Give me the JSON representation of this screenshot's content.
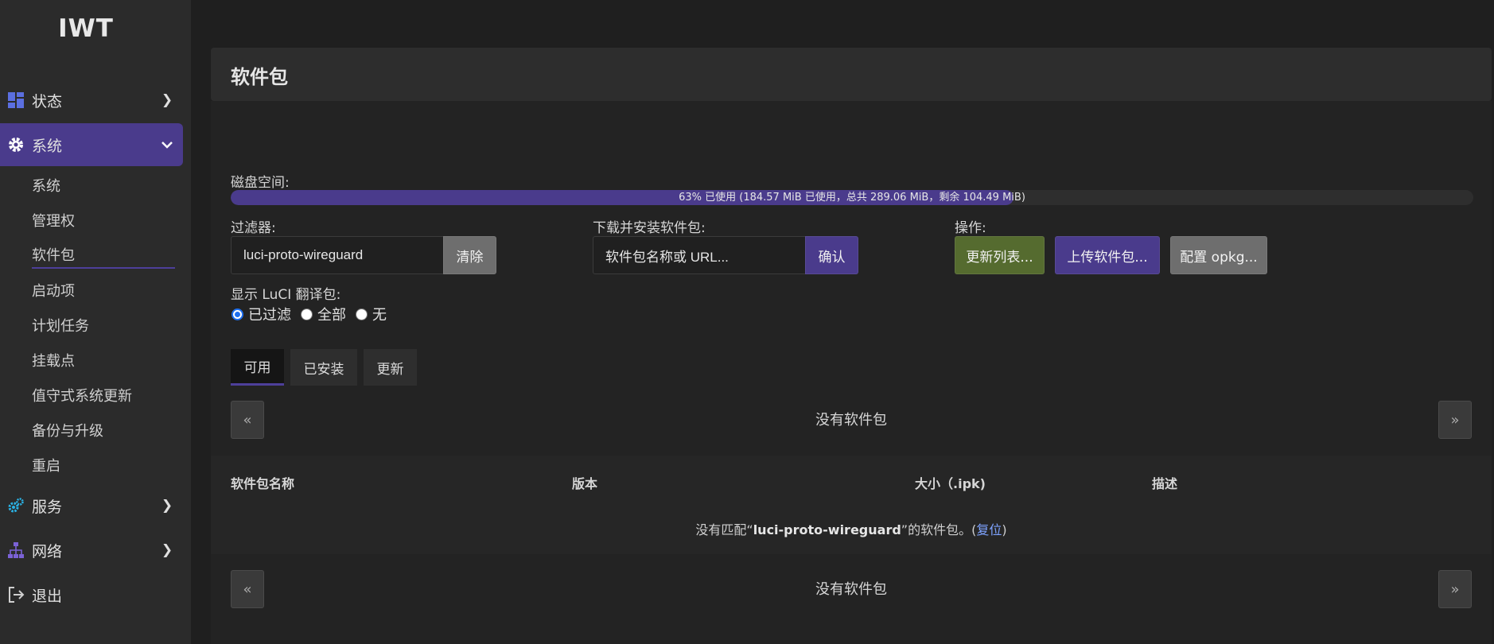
{
  "sidebar": {
    "logo": "IWT",
    "items": [
      {
        "label": "状态",
        "icon": "dashboard-icon",
        "expanded": false
      },
      {
        "label": "系统",
        "icon": "gear-icon",
        "expanded": true
      },
      {
        "label": "服务",
        "icon": "services-gear-icon",
        "expanded": false
      },
      {
        "label": "网络",
        "icon": "network-icon",
        "expanded": false
      },
      {
        "label": "退出",
        "icon": "logout-icon"
      }
    ],
    "sub_items": [
      "系统",
      "管理权",
      "软件包",
      "启动项",
      "计划任务",
      "挂载点",
      "值守式系统更新",
      "备份与升级",
      "重启"
    ],
    "current_sub": "软件包"
  },
  "page": {
    "title": "软件包",
    "disk_label": "磁盘空间:",
    "disk_used_fraction": 0.63,
    "disk_text": "63% 已使用 (184.57 MiB 已使用，总共 289.06 MiB，剩余 104.49 MiB)",
    "filter_label": "过滤器:",
    "filter_value": "luci-proto-wireguard",
    "clear_button": "清除",
    "download_label": "下载并安装软件包:",
    "download_placeholder": "软件包名称或 URL...",
    "confirm_button": "确认",
    "actions_label": "操作:",
    "update_lists_button": "更新列表...",
    "upload_button": "上传软件包...",
    "configure_button": "配置 opkg...",
    "luci_label": "显示 LuCI 翻译包:",
    "radio_options": [
      "已过滤",
      "全部",
      "无"
    ],
    "radio_selected": "已过滤",
    "tabs": [
      "可用",
      "已安装",
      "更新"
    ],
    "active_tab": "可用",
    "pager_prev": "«",
    "pager_next": "»",
    "no_packages": "没有软件包",
    "columns": [
      "软件包名称",
      "版本",
      "大小（.ipk)",
      "描述"
    ],
    "no_match_prefix": "没有匹配“",
    "no_match_query": "luci-proto-wireguard",
    "no_match_suffix": "”的软件包。(",
    "reset_link": "复位",
    "no_match_close": ")"
  },
  "colors": {
    "accent": "#4a3b8c",
    "update_button": "#556b2f",
    "link": "#7ea3ff"
  }
}
